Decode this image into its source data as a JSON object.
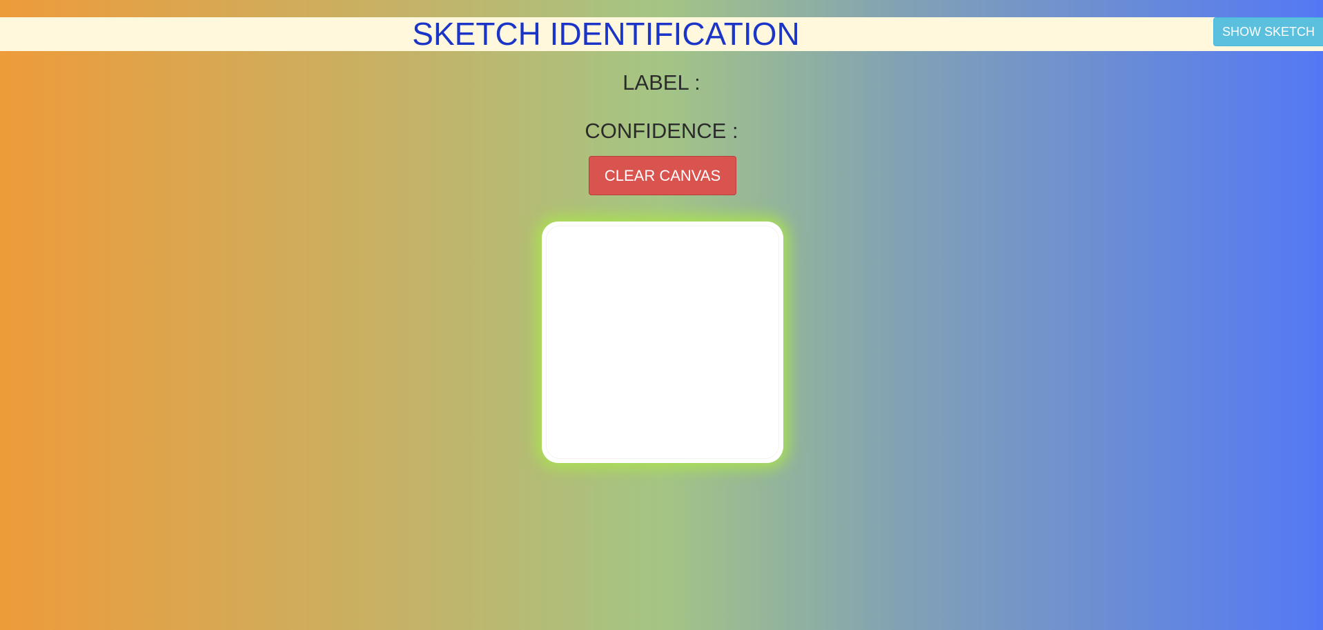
{
  "header": {
    "title": "SKETCH IDENTIFICATION",
    "show_sketch_label": "SHOW SKETCH"
  },
  "prediction": {
    "label_text": "LABEL :",
    "confidence_text": "CONFIDENCE :"
  },
  "controls": {
    "clear_canvas_label": "CLEAR CANVAS"
  },
  "colors": {
    "title": "#1b35c7",
    "header_bg": "#fff8dc",
    "show_sketch_bg": "#5bc0de",
    "clear_canvas_bg": "#d9534f",
    "canvas_glow": "#aae150",
    "gradient_start": "#ee9b3a",
    "gradient_end": "#5478f5"
  }
}
